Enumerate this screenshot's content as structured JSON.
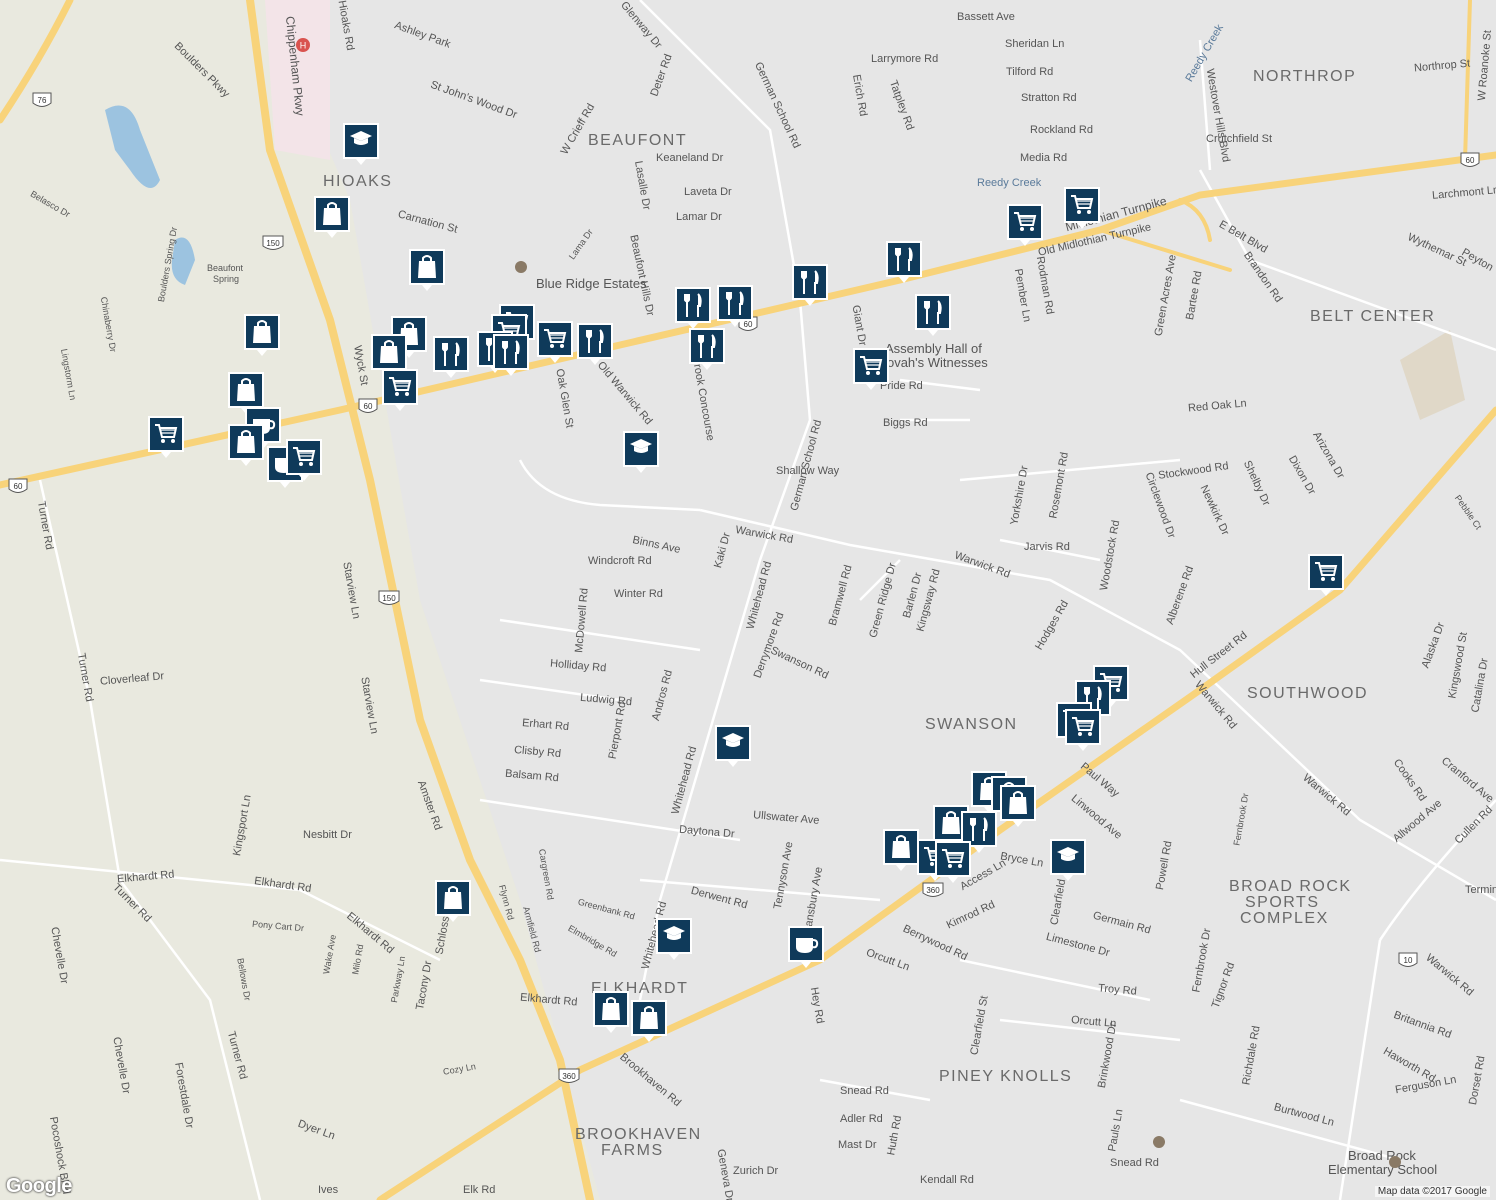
{
  "neighborhoods": [
    {
      "name": "BEAUFONT"
    },
    {
      "name": "HIOAKS"
    },
    {
      "name": "NORTHROP"
    },
    {
      "name": "BELT CENTER"
    },
    {
      "name": "SWANSON"
    },
    {
      "name": "SOUTHWOOD"
    },
    {
      "name": "BROAD ROCK"
    },
    {
      "name": "SPORTS"
    },
    {
      "name": "COMPLEX"
    },
    {
      "name": "ELKHARDT"
    },
    {
      "name": "PINEY KNOLLS"
    },
    {
      "name": "BROOKHAVEN"
    },
    {
      "name": "FARMS"
    }
  ],
  "pois": [
    {
      "name": "Blue Ridge Estates"
    },
    {
      "name": "Assembly Hall of"
    },
    {
      "name": "Jehovah's Witnesses"
    },
    {
      "name": "Broad Rock"
    },
    {
      "name": "Elementary School"
    },
    {
      "name": "Beaufont"
    },
    {
      "name": "Spring"
    }
  ],
  "streets": [
    "Chippenham Pkwy",
    "Hioaks Rd",
    "Ashley Park",
    "St John's Wood Dr",
    "Boulders Pkwy",
    "Belasco Dr",
    "Boulders Spring Dr",
    "Carnation St",
    "Lama Dr",
    "Beaufont Hills Dr",
    "Lasalle Dr",
    "Laveta Dr",
    "Lamar Dr",
    "Keaneland Dr",
    "W Crieff Rd",
    "Deter Rd",
    "Glenway Dr",
    "German School Rd",
    "Erich Rd",
    "Tatpley Rd",
    "Larrymore Rd",
    "Bassett Ave",
    "Sheridan Ln",
    "Tilford Rd",
    "Stratton Rd",
    "Rockland Rd",
    "Media Rd",
    "Reedy Creek",
    "Midlothian Turnpike",
    "Old Midlothian Turnpike",
    "Westover Hills Blvd",
    "Crutchfield St",
    "Northrop St",
    "W Roanoke St",
    "Larchmont Ln",
    "Wythemar St",
    "Peyton",
    "E Belt Blvd",
    "Brandon Rd",
    "Green Acres Ave",
    "Bartee Rd",
    "Rodman Rd",
    "Pember Ln",
    "Giant Dr",
    "Pride Rd",
    "Biggs Rd",
    "Shallow Way",
    "Old Warwick Rd",
    "Oak Glen St",
    "Wyck St",
    "Luebrook Concourse",
    "Red Oak Ln",
    "Stockwood Rd",
    "Circlewood Dr",
    "Newkirk Dr",
    "Shelby Dr",
    "Dixon Dr",
    "Arizona Dr",
    "Pebble Ct",
    "Yorkshire Dr",
    "Rosemont Rd",
    "Jarvis Rd",
    "Woodstock Rd",
    "Warwick Rd",
    "Binns Ave",
    "Kaki Dr",
    "Windcroft Rd",
    "Winter Rd",
    "Whitehead Rd",
    "Bramwell Rd",
    "Green Ridge Dr",
    "Barlen Dr",
    "Kingsway Rd",
    "Derrymore Rd",
    "Swanson Rd",
    "McDowell Rd",
    "Holliday Rd",
    "Ludwig Rd",
    "Andros Rd",
    "Erhart Rd",
    "Clisby Rd",
    "Pierpont Rd",
    "Balsam Rd",
    "Hodges Rd",
    "Alberene Rd",
    "Hull Street Rd",
    "Alaska Dr",
    "Kingswood St",
    "Catalina Dr",
    "Paul Way",
    "Linwood Ave",
    "Cooks Rd",
    "Cranford Ave",
    "Allwood Ave",
    "Cullen Rd",
    "Ullswater Ave",
    "Daytona Dr",
    "Bryce Ln",
    "Access Ln",
    "Clearfield St",
    "Germain Rd",
    "Powell Rd",
    "Fernbrook Dr",
    "Derwent Rd",
    "Tennyson Ave",
    "Bansbury Ave",
    "Kimrod Rd",
    "Limestone Dr",
    "Berrywood Rd",
    "Orcutt Ln",
    "Troy Rd",
    "Brinkwood Dr",
    "Tignor Rd",
    "Richdale Rd",
    "Britannia Rd",
    "Haworth Rd",
    "Turner Rd",
    "Cloverleaf Dr",
    "Starview Ln",
    "Amster Rd",
    "Nesbitt Dr",
    "Kingsport Ln",
    "Elkhardt Rd",
    "Pony Cart Dr",
    "Wake Ave",
    "Milo Rd",
    "Bellows Dr",
    "Parkway Ln",
    "Tacony Dr",
    "Schloss",
    "Flynn Rd",
    "Cargreen Rd",
    "Greenbank Rd",
    "Armfield Rd",
    "Elmbridge Rd",
    "Cozy Ln",
    "Chevelle Dr",
    "Forestdale Dr",
    "Pocoshock Blvd",
    "Dyer Ln",
    "Brookhaven Rd",
    "Hey Rd",
    "Snead Rd",
    "Adler Rd",
    "Mast Dr",
    "Huth Rd",
    "Zurich Dr",
    "Kendall Rd",
    "Pauls Ln",
    "Burtwood Ln",
    "Ferguson Ln",
    "Dorset Rd",
    "Lingstorm Ln",
    "Chinaberry Dr",
    "Ives",
    "Elk Rd",
    "Geneva Dr",
    "Terminal"
  ],
  "shields": [
    "60",
    "150",
    "360",
    "76",
    "10"
  ],
  "icons": {
    "school": "school-icon",
    "shopping": "shopping-bag-icon",
    "grocery": "grocery-cart-icon",
    "restaurant": "restaurant-icon",
    "cafe": "cafe-icon",
    "hospital": "hospital-icon"
  },
  "colors": {
    "marker": "#0f3a5a",
    "highway": "#f8d37a",
    "land": "#e6e6e6",
    "park": "#e6ebd6",
    "water": "#9cc3e0"
  },
  "attribution": "Map data ©2017 Google",
  "logo": "Google"
}
